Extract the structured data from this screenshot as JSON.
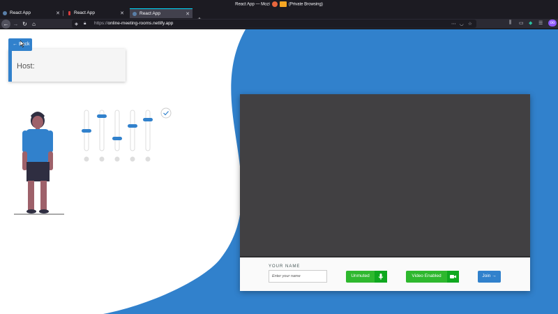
{
  "window": {
    "title_left": "React App — Mozi",
    "title_right": "(Private Browsing)"
  },
  "tabs": [
    {
      "label": "React App",
      "active": false
    },
    {
      "label": "React App",
      "active": false
    },
    {
      "label": "React App",
      "active": true
    }
  ],
  "toolbar": {
    "url_scheme": "https://",
    "url_host": "online-meeting-rooms.netlify.app"
  },
  "page": {
    "back_label": "← Back",
    "host_label": "Host:",
    "your_name_label": "YOUR NAME",
    "name_placeholder": "Enter your name",
    "unmuted_label": "Unmuted",
    "video_label": "Video Enabled",
    "join_label": "Join →"
  },
  "colors": {
    "accent_blue": "#3181cc",
    "button_green": "#2eb82e",
    "video_bg": "#414042"
  },
  "icons": [
    "back-arrow-icon",
    "forward-arrow-icon",
    "reload-icon",
    "home-icon",
    "shield-icon",
    "lock-icon",
    "pocket-icon",
    "star-icon",
    "library-icon",
    "sidebar-icon",
    "extension-icon",
    "menu-icon",
    "microphone-icon",
    "video-camera-icon",
    "check-icon",
    "person-illustration",
    "sliders-illustration"
  ]
}
